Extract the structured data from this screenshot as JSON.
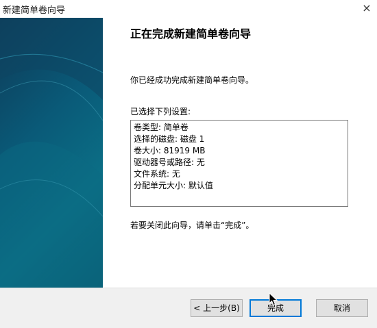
{
  "window": {
    "title": "新建简单卷向导",
    "close_glyph": "×"
  },
  "content": {
    "heading": "正在完成新建简单卷向导",
    "intro": "你已经成功完成新建简单卷向导。",
    "settings_label": "已选择下列设置:",
    "settings": [
      "卷类型: 简单卷",
      "选择的磁盘: 磁盘 1",
      "卷大小: 81919 MB",
      "驱动器号或路径: 无",
      "文件系统: 无",
      "分配单元大小: 默认值"
    ],
    "finish_note": "若要关闭此向导，请单击“完成”。"
  },
  "buttons": {
    "back": "< 上一步(B)",
    "finish": "完成",
    "cancel": "取消"
  },
  "colors": {
    "accent": "#0078d7",
    "side_panel": "#0b5f7a"
  }
}
